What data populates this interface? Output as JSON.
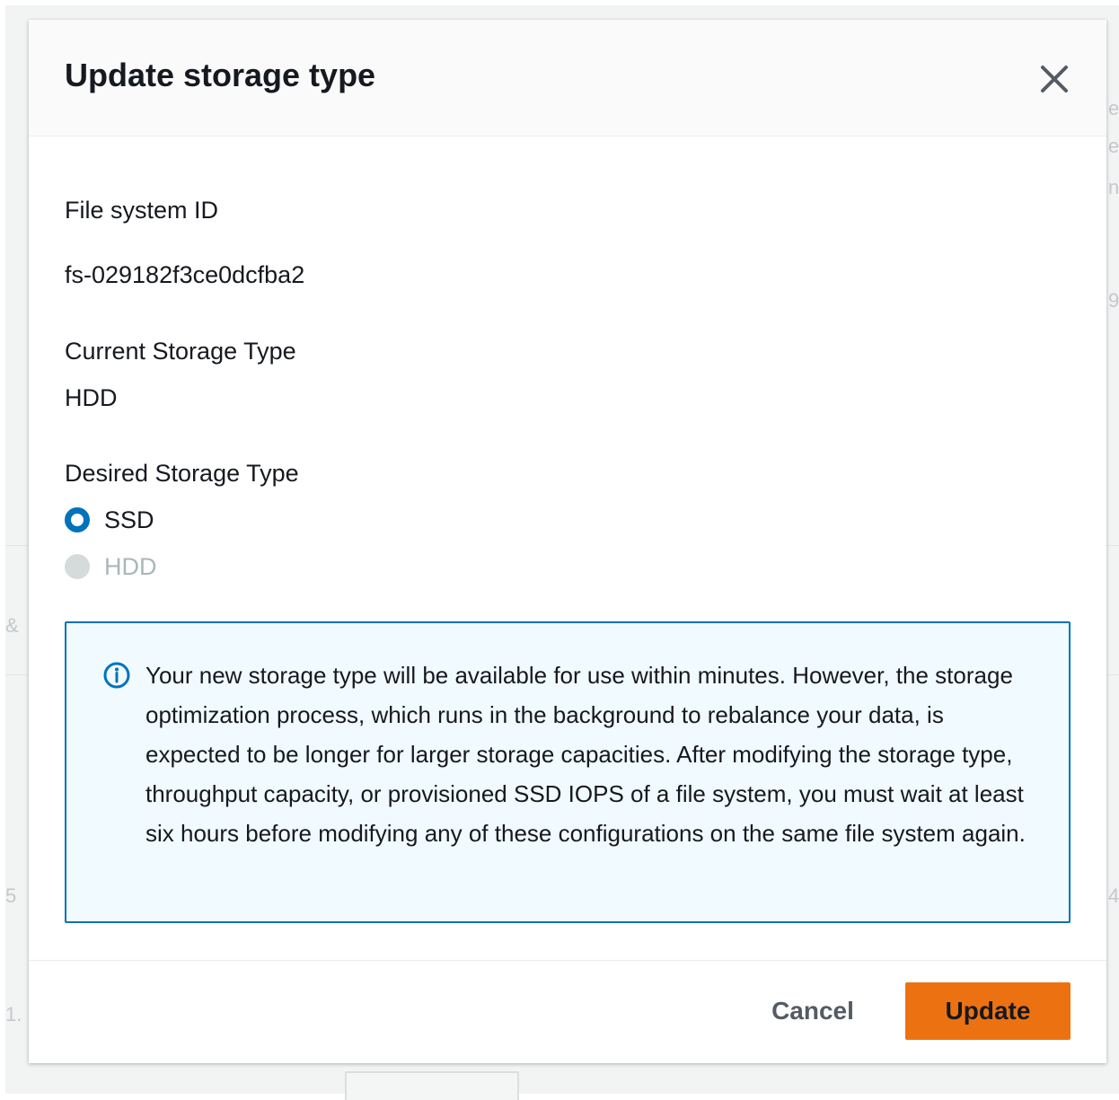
{
  "modal": {
    "title": "Update storage type"
  },
  "file_system": {
    "label": "File system ID",
    "value": "fs-029182f3ce0dcfba2"
  },
  "current_storage": {
    "label": "Current Storage Type",
    "value": "HDD"
  },
  "desired_storage": {
    "label": "Desired Storage Type",
    "options": [
      {
        "label": "SSD",
        "selected": true,
        "disabled": false
      },
      {
        "label": "HDD",
        "selected": false,
        "disabled": true
      }
    ]
  },
  "info": {
    "icon": "info-icon",
    "text": "Your new storage type will be available for use within minutes. However, the storage optimization process, which runs in the background to rebalance your data, is expected to be longer for larger storage capacities. After modifying the storage type, throughput capacity, or provisioned SSD IOPS of a file system, you must wait at least six hours before modifying any of these configurations on the same file system again."
  },
  "footer": {
    "cancel_label": "Cancel",
    "update_label": "Update"
  },
  "colors": {
    "accent": "#0073bb",
    "primary_button": "#ec7211",
    "info_background": "#f1faff"
  }
}
